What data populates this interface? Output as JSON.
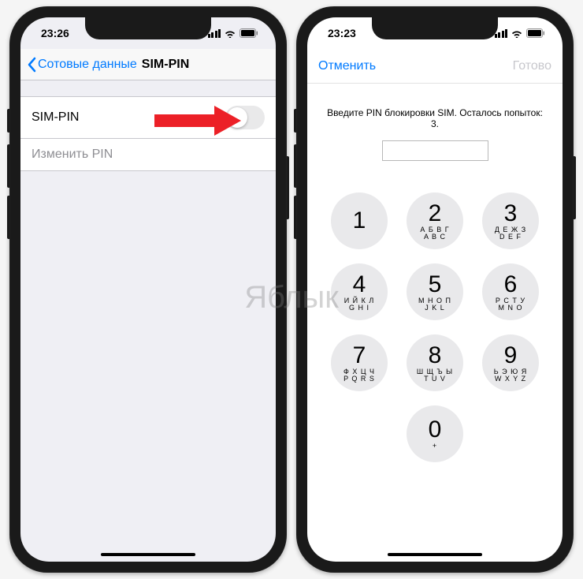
{
  "watermark": "Яблык",
  "left": {
    "time": "23:26",
    "nav": {
      "back": "Сотовые данные",
      "title": "SIM-PIN"
    },
    "rows": {
      "sim_pin": "SIM-PIN",
      "change_pin": "Изменить PIN"
    }
  },
  "right": {
    "time": "23:23",
    "modal": {
      "cancel": "Отменить",
      "done": "Готово"
    },
    "prompt": "Введите PIN блокировки SIM. Осталось попыток: 3.",
    "keys": [
      {
        "d": "1",
        "l": ""
      },
      {
        "d": "2",
        "l": "А Б В Г\nA B C"
      },
      {
        "d": "3",
        "l": "Д Е Ж З\nD E F"
      },
      {
        "d": "4",
        "l": "И Й К Л\nG H I"
      },
      {
        "d": "5",
        "l": "М Н О П\nJ K L"
      },
      {
        "d": "6",
        "l": "Р С Т У\nM N O"
      },
      {
        "d": "7",
        "l": "Ф Х Ц Ч\nP Q R S"
      },
      {
        "d": "8",
        "l": "Ш Щ Ъ Ы\nT U V"
      },
      {
        "d": "9",
        "l": "Ь Э Ю Я\nW X Y Z"
      },
      {
        "d": "0",
        "l": "+"
      }
    ]
  }
}
